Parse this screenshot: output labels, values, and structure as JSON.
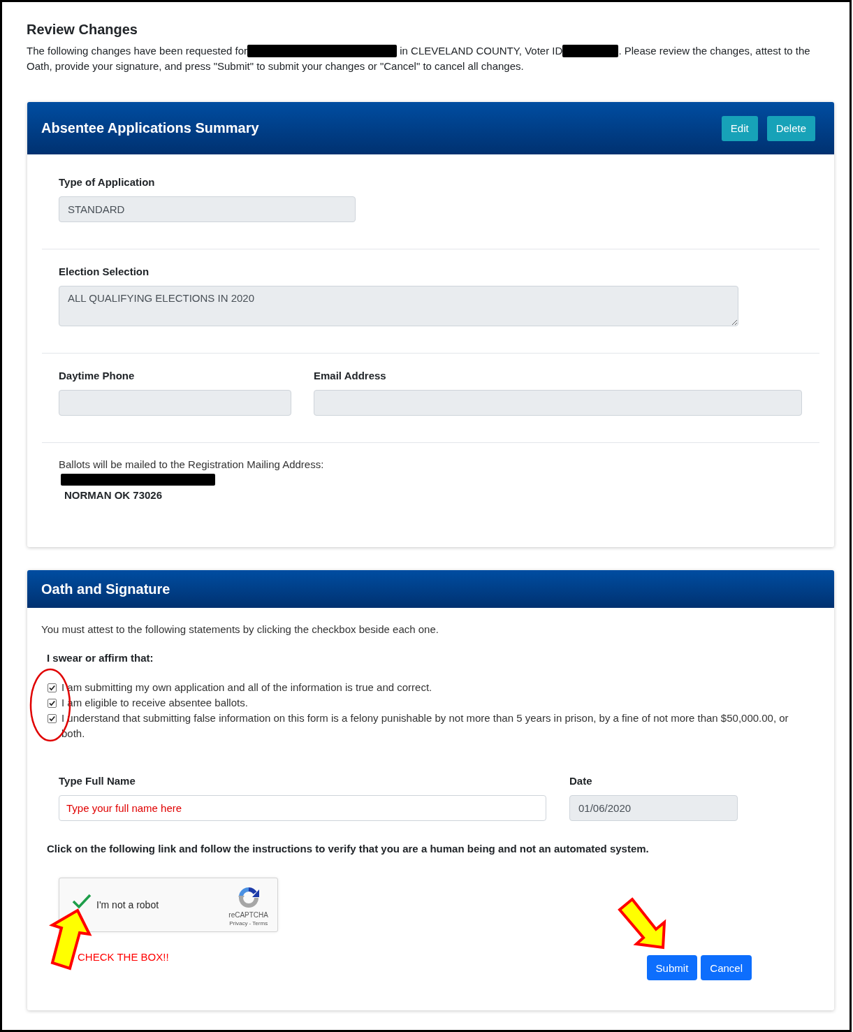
{
  "page": {
    "title": "Review Changes",
    "intro": [
      {
        "kind": "text",
        "text": "The following changes have been requested for"
      },
      {
        "kind": "redacted"
      },
      {
        "kind": "text",
        "text": " in CLEVELAND COUNTY, Voter ID"
      },
      {
        "kind": "redacted"
      },
      {
        "kind": "text",
        "text": ". Please review the changes, attest to the Oath, provide your signature, and press \"Submit\" to submit your changes or \"Cancel\" to cancel all changes."
      }
    ]
  },
  "summary": {
    "title": "Absentee Applications Summary",
    "actions": [
      {
        "label": "Edit"
      },
      {
        "label": "Delete"
      }
    ],
    "sections": [
      {
        "kind": "fields",
        "fields": [
          {
            "label": "Type of Application",
            "kind": "input",
            "value": "STANDARD",
            "disabled": true
          }
        ]
      },
      {
        "kind": "fields",
        "fields": [
          {
            "label": "Election Selection",
            "kind": "textarea",
            "value": "ALL QUALIFYING ELECTIONS IN 2020",
            "disabled": true
          }
        ]
      },
      {
        "kind": "fields",
        "fields": [
          {
            "label": "Daytime Phone",
            "kind": "input",
            "disabled": true
          },
          {
            "label": "Email Address",
            "kind": "input",
            "disabled": true
          }
        ]
      },
      {
        "kind": "address",
        "text": "Ballots will be mailed to the Registration Mailing Address:",
        "lines": [
          {
            "kind": "redacted"
          },
          {
            "kind": "text",
            "text": "NORMAN OK 73026"
          }
        ]
      }
    ]
  },
  "oath": {
    "title": "Oath and Signature",
    "instructions": "You must attest to the following statements by clicking the checkbox beside each one.",
    "heading": "I swear or affirm that:",
    "statements": [
      {
        "text": "I am submitting my own application and all of the information is true and correct.",
        "checked": true
      },
      {
        "text": "I am eligible to receive absentee ballots.",
        "checked": true
      },
      {
        "text": "I understand that submitting false information on this form is a felony punishable by not more than 5 years in prison, by a fine of not more than $50,000.00, or both.",
        "checked": true
      }
    ],
    "fields": [
      {
        "label": "Type Full Name",
        "kind": "input",
        "placeholder": "Type your full name here",
        "disabled": false
      },
      {
        "label": "Date",
        "kind": "input",
        "value": "01/06/2020",
        "disabled": true
      }
    ],
    "captcha_prompt": "Click on the following link and follow the instructions to verify that you are a human being and not an automated system.",
    "captcha": {
      "label": "I'm not a robot",
      "checked": true,
      "brand": "reCAPTCHA",
      "links": "Privacy - Terms"
    },
    "note": "CHECK THE BOX!!",
    "buttons": [
      {
        "label": "Submit"
      },
      {
        "label": "Cancel"
      }
    ]
  }
}
